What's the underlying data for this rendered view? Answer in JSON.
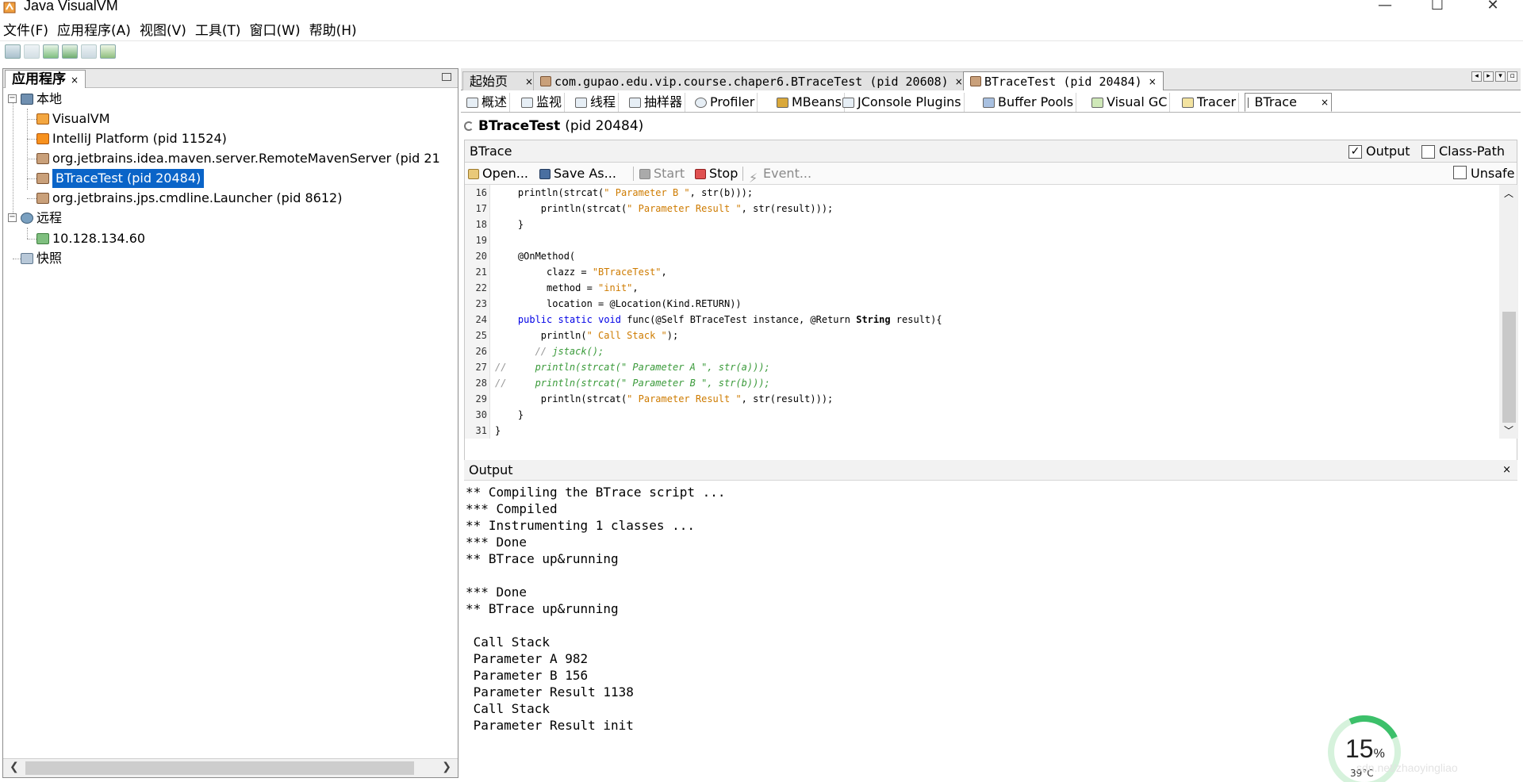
{
  "window": {
    "title": "Java VisualVM",
    "controls": {
      "minimize": "—",
      "maximize": "☐",
      "close": "✕"
    }
  },
  "menu": [
    "文件(F)",
    "应用程序(A)",
    "视图(V)",
    "工具(T)",
    "窗口(W)",
    "帮助(H)"
  ],
  "left_panel": {
    "tab_label": "应用程序",
    "close": "×",
    "tree": {
      "local": "本地",
      "local_items": [
        "VisualVM",
        "IntelliJ Platform (pid 11524)",
        "org.jetbrains.idea.maven.server.RemoteMavenServer (pid 21",
        "BTraceTest (pid 20484)",
        "org.jetbrains.jps.cmdline.Launcher (pid 8612)"
      ],
      "remote": "远程",
      "remote_items": [
        "10.128.134.60"
      ],
      "snapshots": "快照"
    }
  },
  "main_tabs": [
    {
      "label": "起始页"
    },
    {
      "label": "com.gupao.edu.vip.course.chaper6.BTraceTest (pid 20608)"
    },
    {
      "label": "BTraceTest (pid 20484)"
    }
  ],
  "sub_tabs": [
    "概述",
    "监视",
    "线程",
    "抽样器",
    "Profiler",
    "MBeans",
    "JConsole Plugins",
    "Buffer Pools",
    "Visual GC",
    "Tracer",
    "BTrace"
  ],
  "process_header": {
    "name": "BTraceTest",
    "pid": "(pid 20484)"
  },
  "btrace": {
    "title": "BTrace",
    "output_checkbox": {
      "label": "Output",
      "checked": true,
      "mark": "✓"
    },
    "classpath_checkbox": {
      "label": "Class-Path",
      "checked": false
    },
    "unsafe_checkbox": {
      "label": "Unsafe",
      "checked": false
    },
    "tools": {
      "open": "Open...",
      "save_as": "Save As...",
      "start": "Start",
      "stop": "Stop",
      "event": "Event..."
    }
  },
  "code_lines": [
    {
      "n": "16",
      "t": "    println(strcat(\" Parameter B \", str(b)));"
    },
    {
      "n": "17",
      "t": "        println(strcat(\" Parameter Result \", str(result)));"
    },
    {
      "n": "18",
      "t": "    }"
    },
    {
      "n": "19",
      "t": ""
    },
    {
      "n": "20",
      "t": "    @OnMethod("
    },
    {
      "n": "21",
      "t": "         clazz = \"BTraceTest\","
    },
    {
      "n": "22",
      "t": "         method = \"init\","
    },
    {
      "n": "23",
      "t": "         location = @Location(Kind.RETURN))"
    },
    {
      "n": "24",
      "t": "    public static void func(@Self BTraceTest instance, @Return String result){"
    },
    {
      "n": "25",
      "t": "        println(\" Call Stack \");"
    },
    {
      "n": "26",
      "t": "       // jstack();"
    },
    {
      "n": "27",
      "t": "//     println(strcat(\" Parameter A \", str(a)));"
    },
    {
      "n": "28",
      "t": "//     println(strcat(\" Parameter B \", str(b)));"
    },
    {
      "n": "29",
      "t": "        println(strcat(\" Parameter Result \", str(result)));"
    },
    {
      "n": "30",
      "t": "    }"
    },
    {
      "n": "31",
      "t": "}"
    }
  ],
  "output": {
    "title": "Output",
    "close": "×",
    "lines": [
      "** Compiling the BTrace script ...",
      "*** Compiled",
      "** Instrumenting 1 classes ...",
      "*** Done",
      "** BTrace up&running",
      "",
      "*** Done",
      "** BTrace up&running",
      "",
      " Call Stack",
      " Parameter A 982",
      " Parameter B 156",
      " Parameter Result 1138",
      " Call Stack",
      " Parameter Result init"
    ]
  },
  "widget": {
    "cpu_value": "15",
    "cpu_unit": "%",
    "temp": "39°C"
  },
  "watermark": "sdn.net/zhaoyingliao"
}
